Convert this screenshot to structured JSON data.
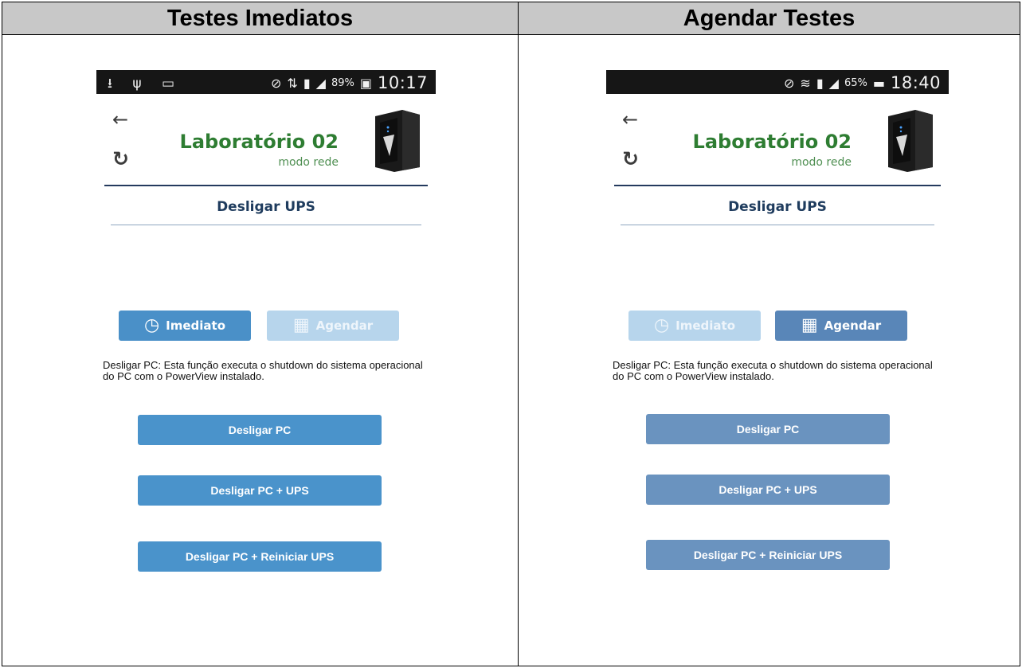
{
  "table": {
    "headers": [
      "Testes Imediatos",
      "Agendar Testes"
    ]
  },
  "left_phone": {
    "status": {
      "left_icons": "⭳ ψ ▭",
      "signal": "89%",
      "time": "10:17"
    },
    "header": {
      "title": "Laboratório 02",
      "subtitle": "modo rede"
    },
    "section_title": "Desligar UPS",
    "mode_buttons": {
      "immediate": "Imediato",
      "schedule": "Agendar"
    },
    "active_mode": "immediate",
    "description": "Desligar PC: Esta função executa o shutdown do sistema operacional do PC com o PowerView instalado.",
    "actions": [
      "Desligar PC",
      "Desligar PC + UPS",
      "Desligar PC + Reiniciar UPS"
    ]
  },
  "right_phone": {
    "status": {
      "signal": "65%",
      "time": "18:40"
    },
    "header": {
      "title": "Laboratório 02",
      "subtitle": "modo rede"
    },
    "section_title": "Desligar UPS",
    "mode_buttons": {
      "immediate": "Imediato",
      "schedule": "Agendar"
    },
    "active_mode": "schedule",
    "description": "Desligar PC: Esta função executa o shutdown do sistema operacional do PC com o PowerView instalado.",
    "actions": [
      "Desligar PC",
      "Desligar PC + UPS",
      "Desligar PC + Reiniciar UPS"
    ]
  },
  "colors": {
    "header_bg": "#c8c8c8",
    "title_green": "#2e7d32",
    "button_blue": "#4a93cb",
    "button_blue_muted": "#6a93bf",
    "button_disabled": "#b7d5ec",
    "statusbar": "#161616"
  },
  "icons": {
    "back": "arrow-left-icon",
    "refresh": "refresh-icon",
    "clock": "clock-icon",
    "calendar": "calendar-icon"
  }
}
